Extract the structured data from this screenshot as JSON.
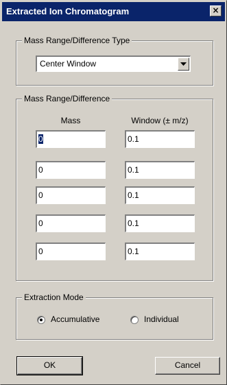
{
  "window": {
    "title": "Extracted Ion Chromatogram",
    "close_glyph": "×"
  },
  "type_group": {
    "legend": "Mass Range/Difference Type",
    "selected": "Center Window"
  },
  "mass_group": {
    "legend": "Mass Range/Difference",
    "mass_header": "Mass",
    "window_header": "Window (± m/z)",
    "rows": [
      {
        "mass": "0",
        "window": "0.1"
      },
      {
        "mass": "0",
        "window": "0.1"
      },
      {
        "mass": "0",
        "window": "0.1"
      },
      {
        "mass": "0",
        "window": "0.1"
      },
      {
        "mass": "0",
        "window": "0.1"
      }
    ]
  },
  "mode_group": {
    "legend": "Extraction Mode",
    "accumulative_label": "Accumulative",
    "individual_label": "Individual",
    "selected": "Accumulative"
  },
  "buttons": {
    "ok": "OK",
    "cancel": "Cancel"
  }
}
